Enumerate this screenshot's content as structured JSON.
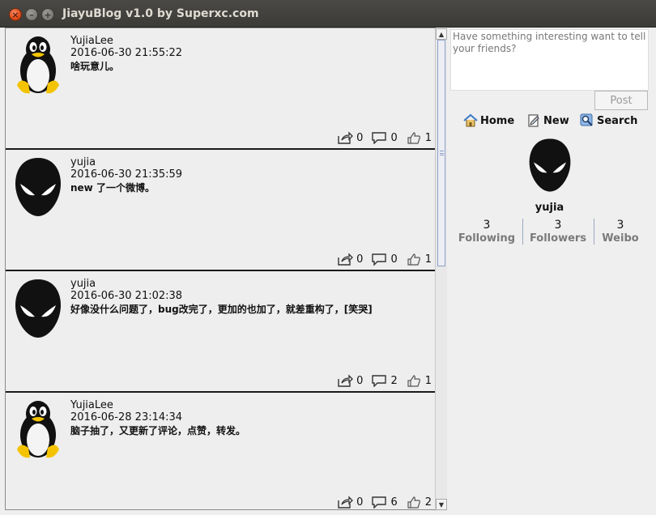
{
  "window": {
    "title": "JiayuBlog v1.0 by Superxc.com"
  },
  "feed": {
    "posts": [
      {
        "user": "YujiaLee",
        "time": "2016-06-30 21:55:22",
        "content": "啥玩意儿。",
        "avatar": "penguin-avatar",
        "forwards": "0",
        "comments": "0",
        "likes": "1"
      },
      {
        "user": "yujia",
        "time": "2016-06-30 21:35:59",
        "content": "new 了一个微博。",
        "avatar": "mask-avatar",
        "forwards": "0",
        "comments": "0",
        "likes": "1"
      },
      {
        "user": "yujia",
        "time": "2016-06-30 21:02:38",
        "content": "好像没什么问题了，bug改完了，更加的也加了，就差重构了，[笑哭]",
        "avatar": "mask-avatar",
        "forwards": "0",
        "comments": "2",
        "likes": "1"
      },
      {
        "user": "YujiaLee",
        "time": "2016-06-28 23:14:34",
        "content": "脑子抽了，又更新了评论，点赞，转发。",
        "avatar": "penguin-avatar",
        "forwards": "0",
        "comments": "6",
        "likes": "2"
      }
    ]
  },
  "compose": {
    "placeholder": "Have something interesting want to tell your friends?",
    "post_label": "Post"
  },
  "nav": {
    "home_label": "Home",
    "new_label": "New",
    "search_label": "Search"
  },
  "profile": {
    "name": "yujia",
    "following_count": "3",
    "following_label": "Following",
    "followers_count": "3",
    "followers_label": "Followers",
    "weibo_count": "3",
    "weibo_label": "Weibo"
  },
  "colors": {
    "accent": "#df4a16",
    "titlebar": "#3c3b37",
    "link_blue": "#3c7bc6"
  }
}
